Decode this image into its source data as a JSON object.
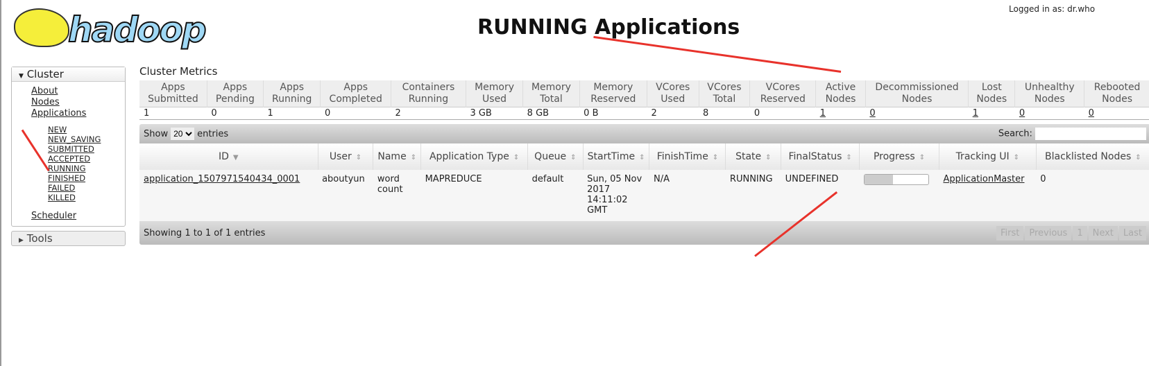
{
  "header": {
    "logo": "hadoop",
    "title": "RUNNING Applications",
    "login": "Logged in as: dr.who"
  },
  "sidebar": {
    "cluster": "Cluster",
    "items": [
      "About",
      "Nodes",
      "Applications"
    ],
    "states": [
      "NEW",
      "NEW_SAVING",
      "SUBMITTED",
      "ACCEPTED",
      "RUNNING",
      "FINISHED",
      "FAILED",
      "KILLED"
    ],
    "scheduler": "Scheduler",
    "tools": "Tools"
  },
  "metrics": {
    "title": "Cluster Metrics",
    "headers": [
      "Apps Submitted",
      "Apps Pending",
      "Apps Running",
      "Apps Completed",
      "Containers Running",
      "Memory Used",
      "Memory Total",
      "Memory Reserved",
      "VCores Used",
      "VCores Total",
      "VCores Reserved",
      "Active Nodes",
      "Decommissioned Nodes",
      "Lost Nodes",
      "Unhealthy Nodes",
      "Rebooted Nodes"
    ],
    "values": [
      "1",
      "0",
      "1",
      "0",
      "2",
      "3 GB",
      "8 GB",
      "0 B",
      "2",
      "8",
      "0",
      "1",
      "0",
      "1",
      "0",
      "0"
    ]
  },
  "apps": {
    "show": "Show",
    "entries": "entries",
    "page_size": "20",
    "search": "Search:",
    "headers": [
      "ID",
      "User",
      "Name",
      "Application Type",
      "Queue",
      "StartTime",
      "FinishTime",
      "State",
      "FinalStatus",
      "Progress",
      "Tracking UI",
      "Blacklisted Nodes"
    ],
    "rows": [
      {
        "id": "application_1507971540434_0001",
        "user": "aboutyun",
        "name": "word count",
        "type": "MAPREDUCE",
        "queue": "default",
        "start": "Sun, 05 Nov 2017 14:11:02 GMT",
        "finish": "N/A",
        "state": "RUNNING",
        "final": "UNDEFINED",
        "progress_percent": 45,
        "tracking": "ApplicationMaster",
        "blacklisted": "0"
      }
    ],
    "info": "Showing 1 to 1 of 1 entries",
    "pager": [
      "First",
      "Previous",
      "1",
      "Next",
      "Last"
    ]
  },
  "colors": {
    "annotation_arrow": "#e8322b"
  }
}
